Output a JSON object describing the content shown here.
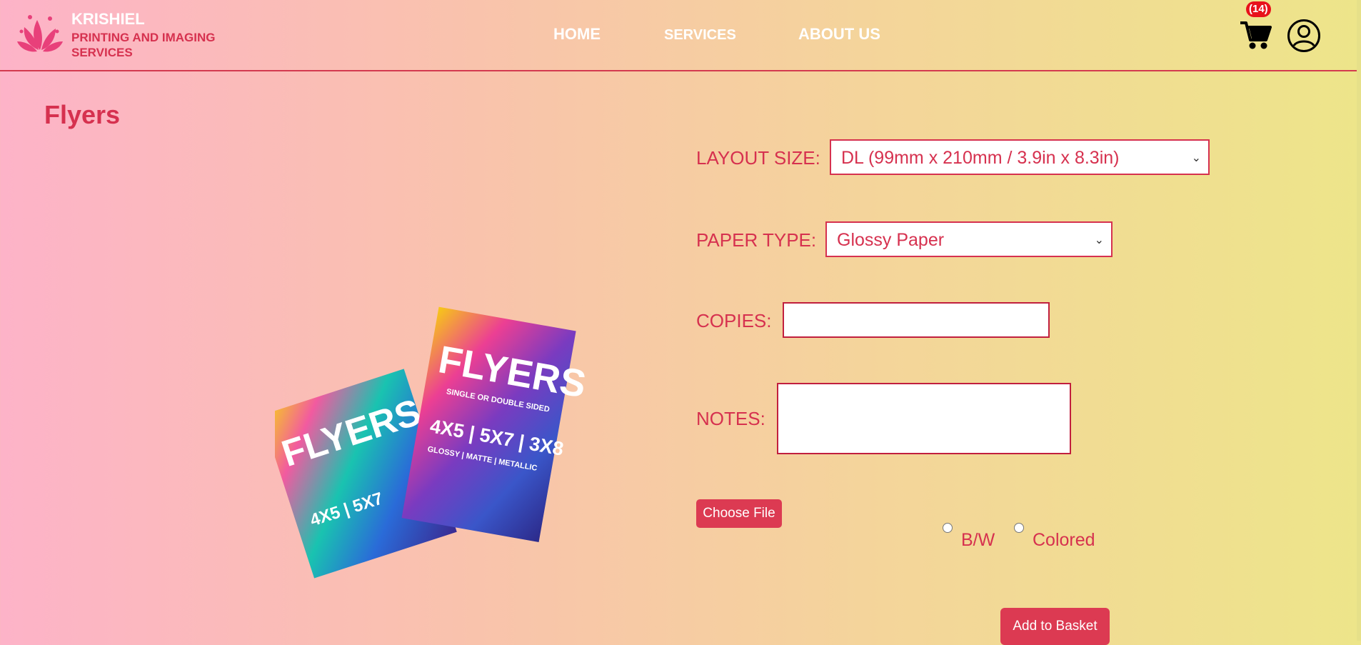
{
  "brand": {
    "name": "KRISHIEL",
    "subtitle": "PRINTING AND IMAGING SERVICES"
  },
  "nav": {
    "home": "HOME",
    "services": "SERVICES",
    "about": "ABOUT US"
  },
  "cart": {
    "count": "(14)"
  },
  "page": {
    "title": "Flyers"
  },
  "form": {
    "layout_size_label": "LAYOUT SIZE:",
    "layout_size_value": "DL (99mm x 210mm / 3.9in x 8.3in)",
    "paper_type_label": "PAPER TYPE:",
    "paper_type_value": "Glossy Paper",
    "copies_label": "COPIES:",
    "copies_value": "",
    "notes_label": "NOTES:",
    "notes_value": "",
    "choose_file_label": "Choose File",
    "color_options": [
      "B/W",
      "Colored"
    ],
    "add_to_basket_label": "Add to Basket"
  },
  "image": {
    "front_title": "FLYERS",
    "front_subtitle": "SINGLE OR DOUBLE SIDED",
    "front_sizes": "4X5 | 5X7 | 3X8",
    "front_finishes": "GLOSSY | MATTE | METALLIC"
  },
  "colors": {
    "accent": "#d6314f",
    "button": "#dc3a52",
    "badge": "#e8111b"
  }
}
